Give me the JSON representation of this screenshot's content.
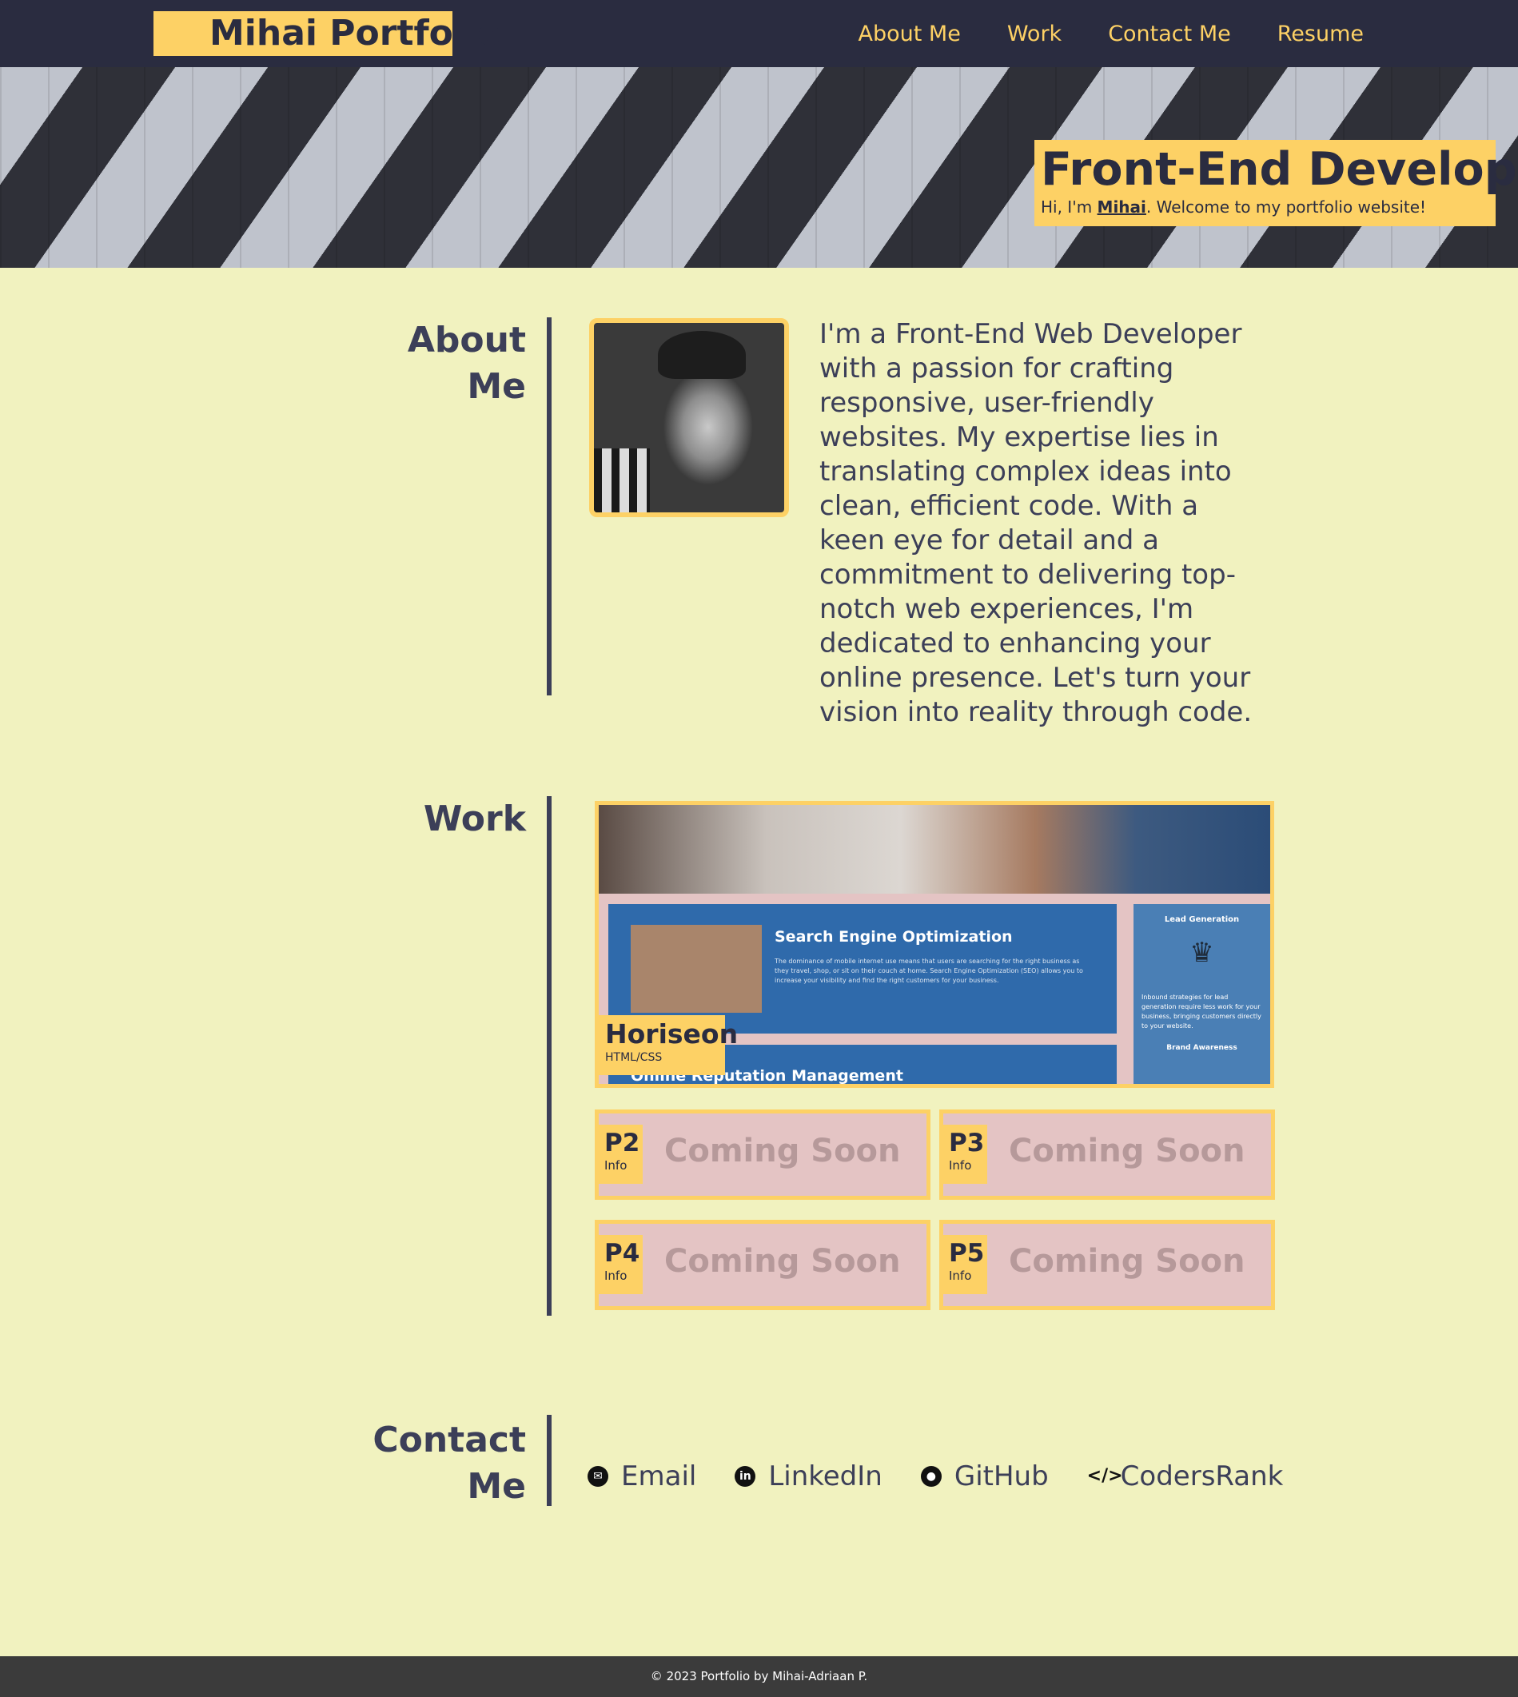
{
  "header": {
    "logo": "Mihai Portfolio",
    "nav": [
      "About Me",
      "Work",
      "Contact Me",
      "Resume"
    ]
  },
  "hero": {
    "title": "Front-End Developer",
    "subtitle_prefix": "Hi, I'm ",
    "subtitle_name": "Mihai",
    "subtitle_suffix": ". Welcome to my portfolio website!"
  },
  "about": {
    "title_line1": "About",
    "title_line2": "Me",
    "text": "I'm a Front-End Web Developer with a passion for crafting responsive, user-friendly websites. My expertise lies in translating complex ideas into clean, efficient code. With a keen eye for detail and a commitment to delivering top-notch web experiences, I'm dedicated to enhancing your online presence. Let's turn your vision into reality through code."
  },
  "work": {
    "title": "Work",
    "main_project": {
      "name": "Horiseon",
      "tech": "HTML/CSS",
      "preview": {
        "seo_heading": "Search Engine Optimization",
        "seo_text": "The dominance of mobile internet use means that users are searching for the right business as they travel, shop, or sit on their couch at home. Search Engine Optimization (SEO) allows you to increase your visibility and find the right customers for your business.",
        "orm_heading": "Online Reputation Management",
        "side_title": "Lead Generation",
        "side_text": "Inbound strategies for lead generation require less work for your business, bringing customers directly to your website.",
        "side_footer": "Brand Awareness"
      }
    },
    "projects": [
      {
        "name": "P2",
        "info": "Info",
        "label": "Coming Soon"
      },
      {
        "name": "P3",
        "info": "Info",
        "label": "Coming Soon"
      },
      {
        "name": "P4",
        "info": "Info",
        "label": "Coming Soon"
      },
      {
        "name": "P5",
        "info": "Info",
        "label": "Coming Soon"
      }
    ]
  },
  "contact": {
    "title_line1": "Contact",
    "title_line2": "Me",
    "links": [
      {
        "label": "Email",
        "icon": "email-icon"
      },
      {
        "label": "LinkedIn",
        "icon": "linkedin-icon"
      },
      {
        "label": "GitHub",
        "icon": "github-icon"
      },
      {
        "label": "CodersRank",
        "icon": "code-icon"
      }
    ]
  },
  "footer": {
    "text": "© 2023 Portfolio by Mihai-Adriaan P."
  },
  "colors": {
    "background": "#f1f2bf",
    "header": "#2a2c40",
    "accent": "#fdd165",
    "text": "#3c3f58",
    "card": "#e4c4c4",
    "footer": "#3b3b3b"
  }
}
